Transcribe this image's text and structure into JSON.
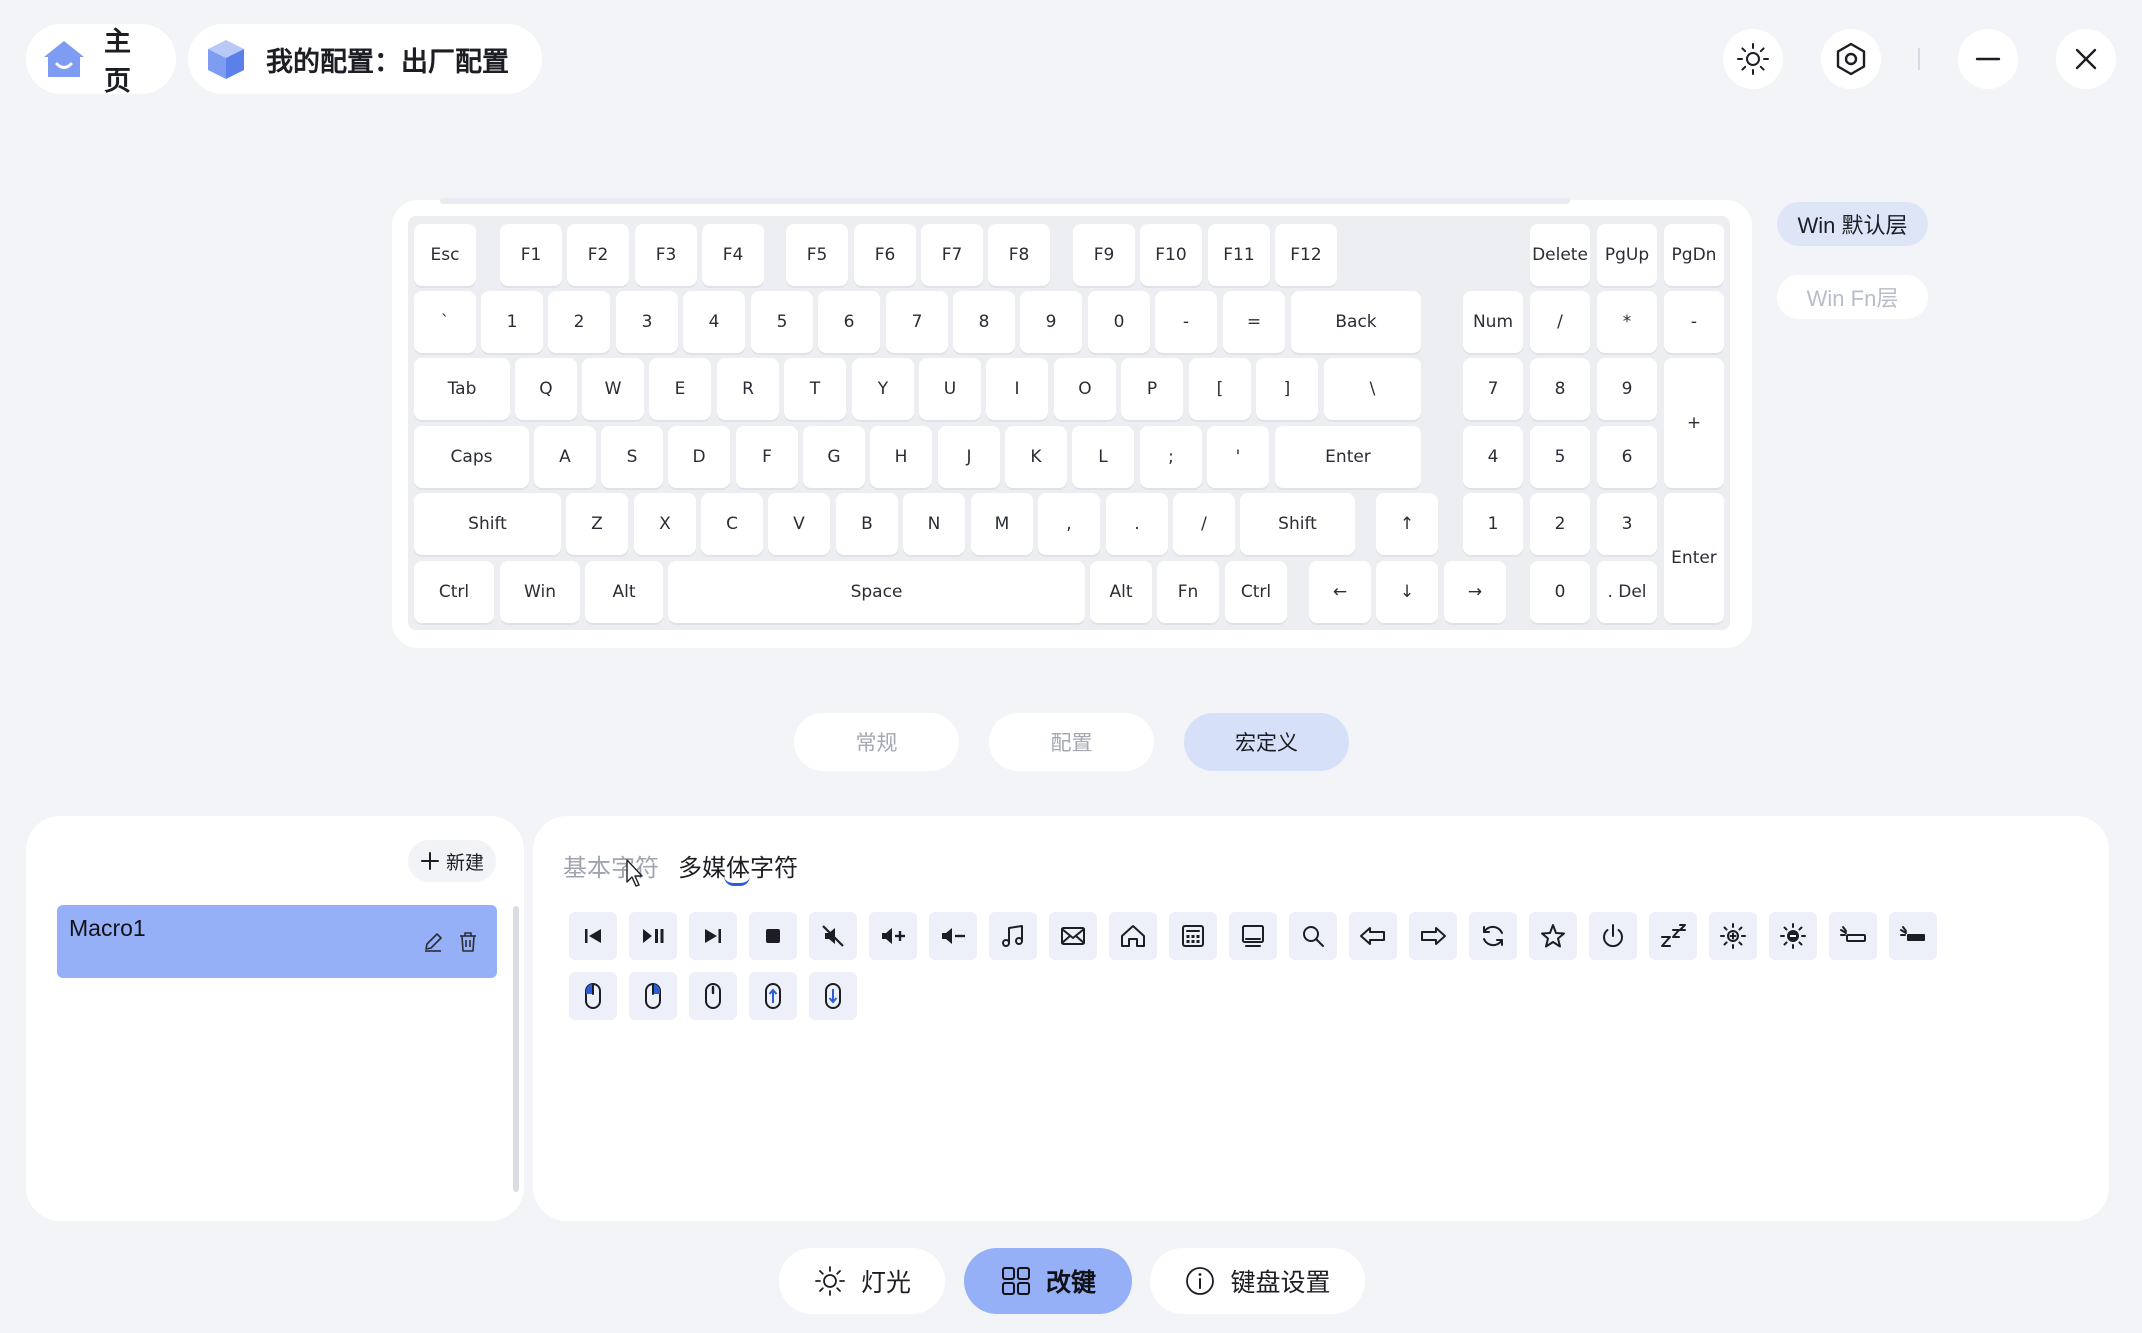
{
  "header": {
    "home_label": "主页",
    "config_label": "我的配置：出厂配置"
  },
  "keyboard": {
    "layers": [
      "Win 默认层",
      "Win Fn层"
    ],
    "rows": [
      [
        "Esc",
        "F1",
        "F2",
        "F3",
        "F4",
        "F5",
        "F6",
        "F7",
        "F8",
        "F9",
        "F10",
        "F11",
        "F12",
        "Delete",
        "PgUp",
        "PgDn"
      ],
      [
        "`",
        "1",
        "2",
        "3",
        "4",
        "5",
        "6",
        "7",
        "8",
        "9",
        "0",
        "-",
        "=",
        "Back",
        "Num",
        "/",
        "*",
        "-"
      ],
      [
        "Tab",
        "Q",
        "W",
        "E",
        "R",
        "T",
        "Y",
        "U",
        "I",
        "O",
        "P",
        "[",
        "]",
        "\\",
        "7",
        "8",
        "9",
        "+"
      ],
      [
        "Caps",
        "A",
        "S",
        "D",
        "F",
        "G",
        "H",
        "J",
        "K",
        "L",
        ";",
        "'",
        "Enter",
        "4",
        "5",
        "6"
      ],
      [
        "Shift",
        "Z",
        "X",
        "C",
        "V",
        "B",
        "N",
        "M",
        ",",
        ".",
        "/",
        "Shift",
        "↑",
        "1",
        "2",
        "3",
        "Enter"
      ],
      [
        "Ctrl",
        "Win",
        "Alt",
        "Space",
        "Alt",
        "Fn",
        "Ctrl",
        "←",
        "↓",
        "→",
        "0",
        ". Del"
      ]
    ]
  },
  "mode_tabs": [
    "常规",
    "配置",
    "宏定义"
  ],
  "macros": {
    "new_label": "新建",
    "items": [
      "Macro1"
    ]
  },
  "char_tabs": [
    "基本字符",
    "多媒体字符"
  ],
  "media_icons": [
    "previous-track-icon",
    "play-pause-icon",
    "next-track-icon",
    "stop-icon",
    "mute-icon",
    "volume-up-icon",
    "volume-down-icon",
    "music-icon",
    "mail-icon",
    "home-icon",
    "calculator-icon",
    "my-computer-icon",
    "search-icon",
    "browser-back-icon",
    "browser-forward-icon",
    "refresh-icon",
    "favorites-icon",
    "power-icon",
    "sleep-icon",
    "brightness-up-icon",
    "brightness-down-icon",
    "backlight-down-icon",
    "backlight-up-icon",
    "mouse-left-click-icon",
    "mouse-right-click-icon",
    "mouse-middle-click-icon",
    "mouse-scroll-up-icon",
    "mouse-scroll-down-icon"
  ],
  "bottom_nav": [
    "灯光",
    "改键",
    "键盘设置"
  ],
  "colors": {
    "accent": "#95b0f6",
    "accent_soft": "#d6e0f8",
    "background": "#f3f4f8"
  }
}
